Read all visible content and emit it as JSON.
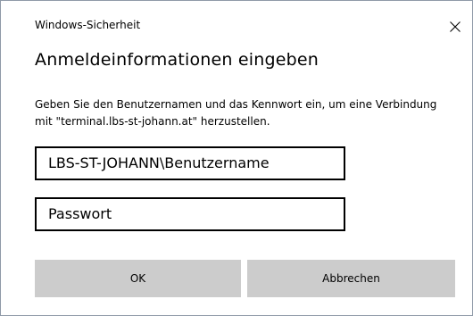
{
  "window": {
    "title": "Windows-Sicherheit",
    "close_icon": "close-icon"
  },
  "dialog": {
    "heading": "Anmeldeinformationen eingeben",
    "description": "Geben Sie den Benutzernamen und das Kennwort ein, um eine Verbindung mit \"terminal.lbs-st-johann.at\" herzustellen."
  },
  "fields": {
    "username_value": "LBS-ST-JOHANN\\Benutzername",
    "password_placeholder": "Passwort"
  },
  "buttons": {
    "ok_label": "OK",
    "cancel_label": "Abbrechen"
  },
  "colors": {
    "button_bg": "#cccccc",
    "field_border": "#000000",
    "window_border": "#8f9aa8"
  }
}
